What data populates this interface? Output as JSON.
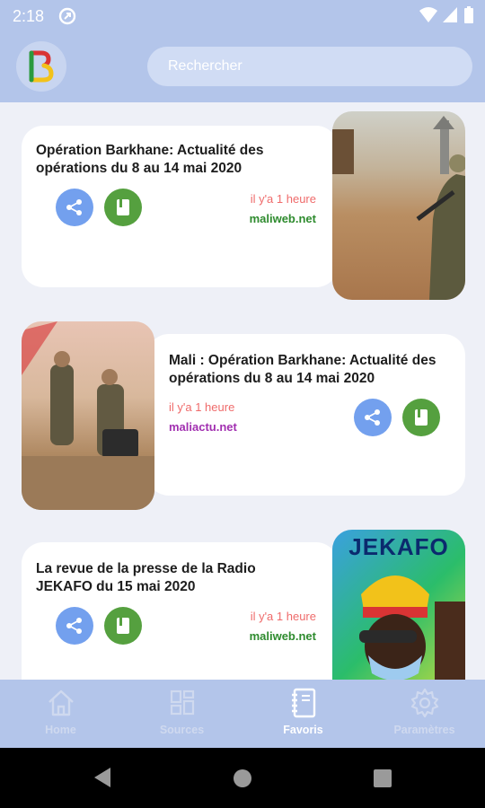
{
  "status_bar": {
    "time": "2:18"
  },
  "header": {
    "search_placeholder": "Rechercher"
  },
  "articles": [
    {
      "title": "Opération Barkhane: Actualité des opérations du 8 au 14 mai 2020",
      "time": "il y'a 1 heure",
      "source": "maliweb.net",
      "source_color": "#2e8b2e"
    },
    {
      "title": "Mali : Opération Barkhane: Actualité des opérations du 8 au 14 mai 2020",
      "time": "il y'a 1 heure",
      "source": "maliactu.net",
      "source_color": "#a12fb0"
    },
    {
      "title": "La revue de la presse de la Radio JEKAFO du 15 mai 2020",
      "time": "il y'a 1 heure",
      "source": "maliweb.net",
      "source_color": "#2e8b2e",
      "image_text": "JEKAFO"
    }
  ],
  "nav": [
    {
      "label": "Home",
      "icon": "home-icon",
      "active": false
    },
    {
      "label": "Sources",
      "icon": "grid-icon",
      "active": false
    },
    {
      "label": "Favoris",
      "icon": "notebook-icon",
      "active": true
    },
    {
      "label": "Paramètres",
      "icon": "gear-icon",
      "active": false
    }
  ],
  "colors": {
    "primary": "#b3c5ea",
    "share": "#73a0ee",
    "favorite": "#55a03f",
    "time": "#ef6b6b"
  }
}
